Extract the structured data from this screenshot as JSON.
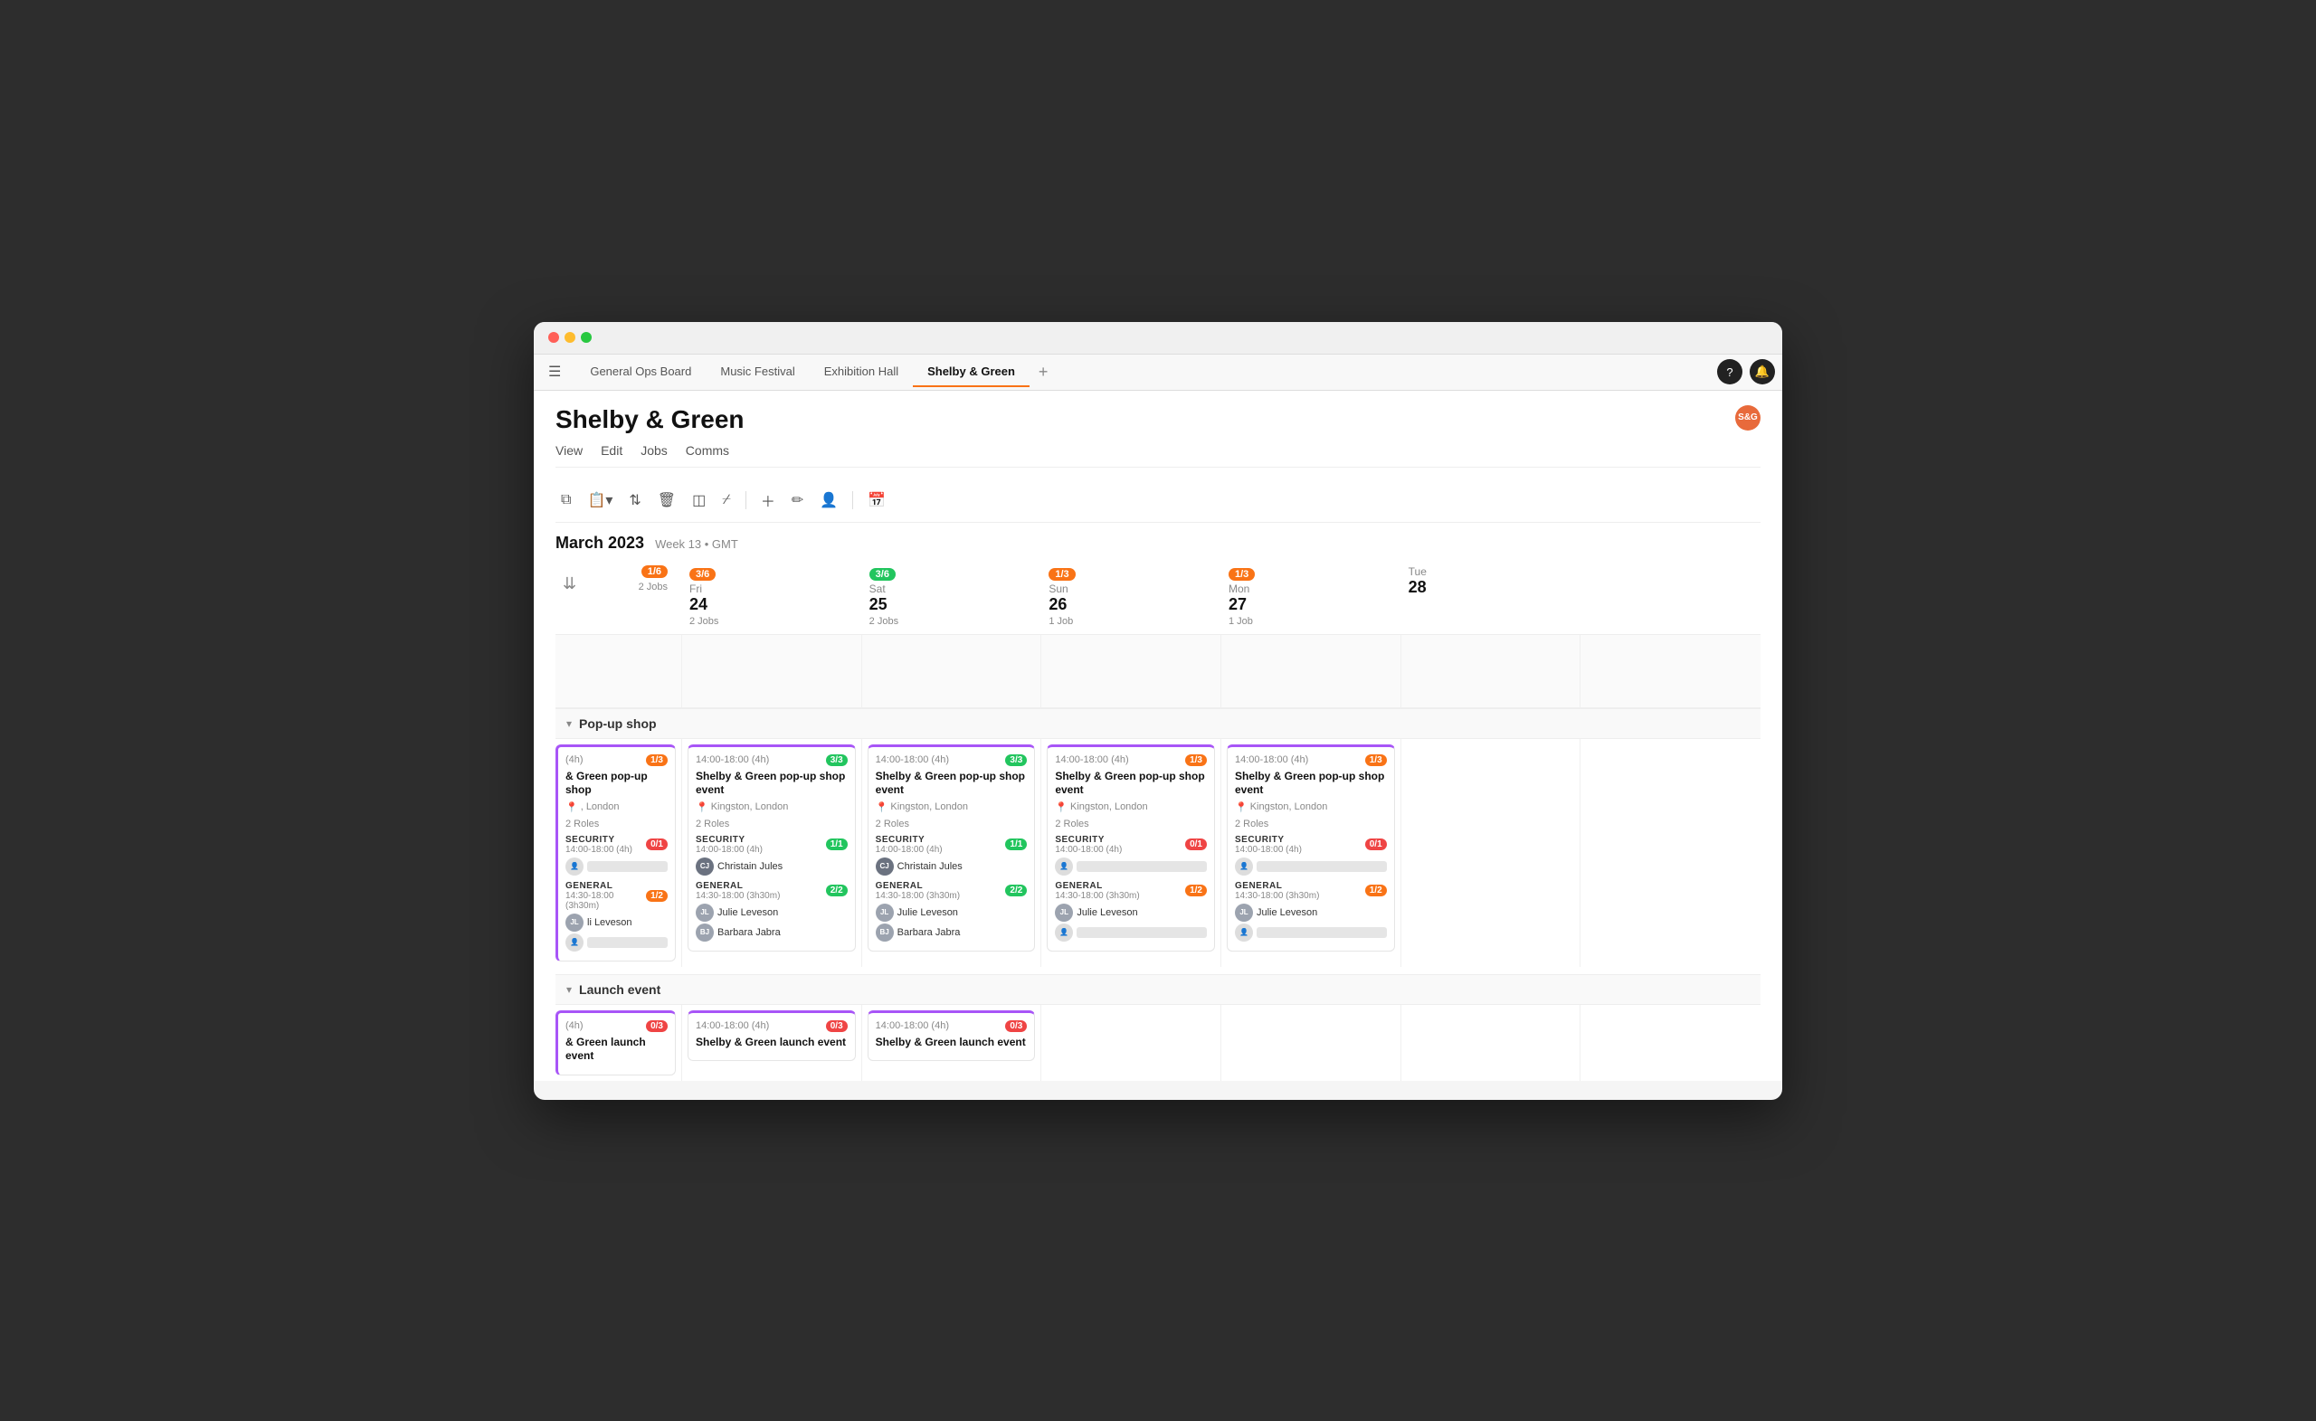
{
  "window": {
    "title": "Shelby & Green"
  },
  "tabs": [
    {
      "label": "General Ops Board",
      "active": false
    },
    {
      "label": "Music Festival",
      "active": false
    },
    {
      "label": "Exhibition Hall",
      "active": false
    },
    {
      "label": "Shelby & Green",
      "active": true
    }
  ],
  "tab_add_label": "+",
  "page_title": "Shelby & Green",
  "page_nav": [
    {
      "label": "View"
    },
    {
      "label": "Edit"
    },
    {
      "label": "Jobs"
    },
    {
      "label": "Comms"
    }
  ],
  "calendar": {
    "month_year": "March 2023",
    "week_info": "Week 13 • GMT",
    "days": [
      {
        "day_name": "",
        "day_num": "",
        "badge": "1/6",
        "badge_type": "orange",
        "jobs": "2 Jobs",
        "is_label_col": true
      },
      {
        "day_name": "Fri",
        "day_num": "24",
        "badge": "3/6",
        "badge_type": "orange",
        "jobs": "2 Jobs"
      },
      {
        "day_name": "Sat",
        "day_num": "25",
        "badge": "3/6",
        "badge_type": "green",
        "jobs": "2 Jobs"
      },
      {
        "day_name": "Sun",
        "day_num": "26",
        "badge": "1/3",
        "badge_type": "orange",
        "jobs": "1 Job"
      },
      {
        "day_name": "Mon",
        "day_num": "27",
        "badge": "1/3",
        "badge_type": "orange",
        "jobs": "1 Job"
      },
      {
        "day_name": "Tue",
        "day_num": "28",
        "badge": "",
        "badge_type": "",
        "jobs": ""
      }
    ]
  },
  "sections": [
    {
      "title": "Pop-up shop",
      "events": [
        {
          "col": 0,
          "time": "(4h)",
          "badge": "1/3",
          "badge_type": "orange",
          "title": "& Green pop-up shop",
          "location": ", London",
          "roles_label": "2 Roles",
          "roles": [
            {
              "name": "SECURITY",
              "time": "14:00-18:00 (4h)",
              "badge": "0/1",
              "badge_type": "red",
              "workers": [
                {
                  "name": "",
                  "placeholder": true
                }
              ]
            },
            {
              "name": "GENERAL",
              "time": "14:30-18:00 (3h30m)",
              "badge": "1/2",
              "badge_type": "orange",
              "workers": [
                {
                  "name": "li Leveson",
                  "placeholder": false
                },
                {
                  "name": "",
                  "placeholder": true
                }
              ]
            }
          ]
        },
        {
          "col": 1,
          "time": "14:00-18:00 (4h)",
          "badge": "3/3",
          "badge_type": "green",
          "title": "Shelby & Green pop-up shop event",
          "location": "Kingston, London",
          "roles_label": "2 Roles",
          "roles": [
            {
              "name": "SECURITY",
              "time": "14:00-18:00 (4h)",
              "badge": "1/1",
              "badge_type": "green",
              "workers": [
                {
                  "name": "Christain Jules",
                  "placeholder": false
                }
              ]
            },
            {
              "name": "GENERAL",
              "time": "14:30-18:00 (3h30m)",
              "badge": "2/2",
              "badge_type": "green",
              "workers": [
                {
                  "name": "Julie Leveson",
                  "placeholder": false
                },
                {
                  "name": "Barbara Jabra",
                  "placeholder": false
                }
              ]
            }
          ]
        },
        {
          "col": 2,
          "time": "14:00-18:00 (4h)",
          "badge": "3/3",
          "badge_type": "green",
          "title": "Shelby & Green pop-up shop event",
          "location": "Kingston, London",
          "roles_label": "2 Roles",
          "roles": [
            {
              "name": "SECURITY",
              "time": "14:00-18:00 (4h)",
              "badge": "1/1",
              "badge_type": "green",
              "workers": [
                {
                  "name": "Christain Jules",
                  "placeholder": false
                }
              ]
            },
            {
              "name": "GENERAL",
              "time": "14:30-18:00 (3h30m)",
              "badge": "2/2",
              "badge_type": "green",
              "workers": [
                {
                  "name": "Julie Leveson",
                  "placeholder": false
                },
                {
                  "name": "Barbara Jabra",
                  "placeholder": false
                }
              ]
            }
          ]
        },
        {
          "col": 3,
          "time": "14:00-18:00 (4h)",
          "badge": "1/3",
          "badge_type": "orange",
          "title": "Shelby & Green pop-up shop event",
          "location": "Kingston, London",
          "roles_label": "2 Roles",
          "roles": [
            {
              "name": "SECURITY",
              "time": "14:00-18:00 (4h)",
              "badge": "0/1",
              "badge_type": "red",
              "workers": [
                {
                  "name": "",
                  "placeholder": true
                }
              ]
            },
            {
              "name": "GENERAL",
              "time": "14:30-18:00 (3h30m)",
              "badge": "1/2",
              "badge_type": "orange",
              "workers": [
                {
                  "name": "Julie Leveson",
                  "placeholder": false
                },
                {
                  "name": "",
                  "placeholder": true
                }
              ]
            }
          ]
        },
        {
          "col": 4,
          "time": "14:00-18:00 (4h)",
          "badge": "1/3",
          "badge_type": "orange",
          "title": "Shelby & Green pop-up shop event",
          "location": "Kingston, London",
          "roles_label": "2 Roles",
          "roles": [
            {
              "name": "SECURITY",
              "time": "14:00-18:00 (4h)",
              "badge": "0/1",
              "badge_type": "red",
              "workers": [
                {
                  "name": "",
                  "placeholder": true
                }
              ]
            },
            {
              "name": "GENERAL",
              "time": "14:30-18:00 (3h30m)",
              "badge": "1/2",
              "badge_type": "orange",
              "workers": [
                {
                  "name": "Julie Leveson",
                  "placeholder": false
                },
                {
                  "name": "",
                  "placeholder": true
                }
              ]
            }
          ]
        },
        {
          "col": 5,
          "time": "",
          "badge": "",
          "badge_type": "",
          "title": "",
          "location": "",
          "roles_label": "",
          "roles": []
        }
      ]
    },
    {
      "title": "Launch event",
      "events": [
        {
          "col": 0,
          "time": "(4h)",
          "badge": "0/3",
          "badge_type": "red",
          "title": "& Green launch event",
          "location": "",
          "roles_label": "",
          "roles": []
        },
        {
          "col": 1,
          "time": "14:00-18:00 (4h)",
          "badge": "0/3",
          "badge_type": "red",
          "title": "Shelby & Green launch event",
          "location": "",
          "roles_label": "",
          "roles": []
        },
        {
          "col": 2,
          "time": "14:00-18:00 (4h)",
          "badge": "0/3",
          "badge_type": "red",
          "title": "Shelby & Green launch event",
          "location": "",
          "roles_label": "",
          "roles": []
        },
        {
          "col": 3,
          "time": "",
          "badge": "",
          "badge_type": "",
          "title": "",
          "location": "",
          "roles_label": "",
          "roles": []
        },
        {
          "col": 4,
          "time": "",
          "badge": "",
          "badge_type": "",
          "title": "",
          "location": "",
          "roles_label": "",
          "roles": []
        },
        {
          "col": 5,
          "time": "",
          "badge": "",
          "badge_type": "",
          "title": "",
          "location": "",
          "roles_label": "",
          "roles": []
        }
      ]
    }
  ],
  "badge_colors": {
    "orange": {
      "bg": "#f97316",
      "text": "#fff"
    },
    "green": {
      "bg": "#22c55e",
      "text": "#fff"
    },
    "red": {
      "bg": "#ef4444",
      "text": "#fff"
    }
  },
  "icons": {
    "menu": "☰",
    "question": "?",
    "bell": "🔔",
    "copy": "⧉",
    "clipboard": "📋",
    "filter": "⇅",
    "trash": "🗑",
    "layers": "◫",
    "slash": "⌿",
    "plus": "+",
    "edit": "✏",
    "person": "👤",
    "calendar": "📅",
    "chevron_down": "▾",
    "location_pin": "📍",
    "collapse": "▾"
  }
}
